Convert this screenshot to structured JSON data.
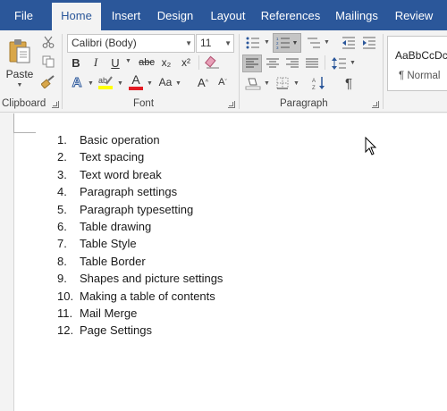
{
  "tabs": [
    "File",
    "Home",
    "Insert",
    "Design",
    "Layout",
    "References",
    "Mailings",
    "Review"
  ],
  "ribbon": {
    "clipboard": {
      "paste_label": "Paste",
      "group_label": "Clipboard"
    },
    "font": {
      "font_name": "Calibri (Body)",
      "font_size": "11",
      "group_label": "Font",
      "bold": "B",
      "italic": "I",
      "underline": "U",
      "strike": "abc",
      "subscript": "x₂",
      "superscript": "x²",
      "grow": "A",
      "shrink": "A",
      "text_effects": "A",
      "font_color": "A",
      "font_color_hex": "#e31b23",
      "highlight_hex": "#ffff00"
    },
    "paragraph": {
      "group_label": "Paragraph",
      "pilcrow": "¶"
    },
    "styles": {
      "preview": "AaBbCcDc",
      "normal_label": "¶ Normal"
    }
  },
  "document": {
    "items": [
      {
        "num": "1.",
        "text": "Basic operation"
      },
      {
        "num": "2.",
        "text": "Text spacing"
      },
      {
        "num": "3.",
        "text": "Text word break"
      },
      {
        "num": "4.",
        "text": "Paragraph settings"
      },
      {
        "num": "5.",
        "text": "Paragraph typesetting"
      },
      {
        "num": "6.",
        "text": "Table drawing"
      },
      {
        "num": "7.",
        "text": "Table Style"
      },
      {
        "num": "8.",
        "text": "Table Border"
      },
      {
        "num": "9.",
        "text": "Shapes and picture settings"
      },
      {
        "num": "10.",
        "text": "Making a table of contents"
      },
      {
        "num": "11.",
        "text": "Mail Merge"
      },
      {
        "num": "12.",
        "text": "Page Settings"
      }
    ]
  }
}
